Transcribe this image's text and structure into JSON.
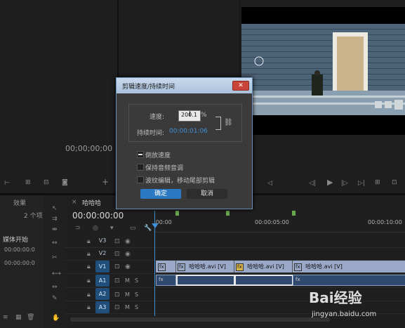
{
  "source_monitor": {
    "timecode": "00;00;00;00"
  },
  "project": {
    "tab": "效果",
    "item_count": "2 个项",
    "column_header": "媒体开始",
    "rows": [
      "00:00:00:0",
      "00:00:00:0"
    ]
  },
  "timeline": {
    "tab": "哈哈哈",
    "timecode": "00:00:00:00",
    "ruler": [
      ":00:00",
      "00:00:05:00",
      "00:00:10:00"
    ],
    "video_tracks": [
      "V3",
      "V2",
      "V1"
    ],
    "audio_tracks": [
      "A1",
      "A2",
      "A3"
    ],
    "track_toggles": {
      "mute": "M",
      "solo": "S"
    },
    "clips": [
      "哈哈哈.avi [V]",
      "哈哈哈.avi [V]",
      "哈哈哈.avi [V]"
    ],
    "fx": "fx"
  },
  "dialog": {
    "title": "剪辑速度/持续时间",
    "speed_label": "速度:",
    "speed_value": "200.1",
    "percent": "%",
    "duration_label": "持续时间:",
    "duration_value": "00:00:01:06",
    "options": [
      {
        "label": "倒放速度",
        "checked": true
      },
      {
        "label": "保持音频音调",
        "checked": false
      },
      {
        "label": "波纹编辑，移动尾部剪辑",
        "checked": false
      }
    ],
    "ok": "确定",
    "cancel": "取消"
  },
  "watermark": {
    "line1": "Bai经验",
    "line2": "jingyan.baidu.com"
  },
  "colors": {
    "accent": "#2b79c2",
    "timecode_blue": "#3f8fd6",
    "playhead": "#3f8fd6"
  }
}
